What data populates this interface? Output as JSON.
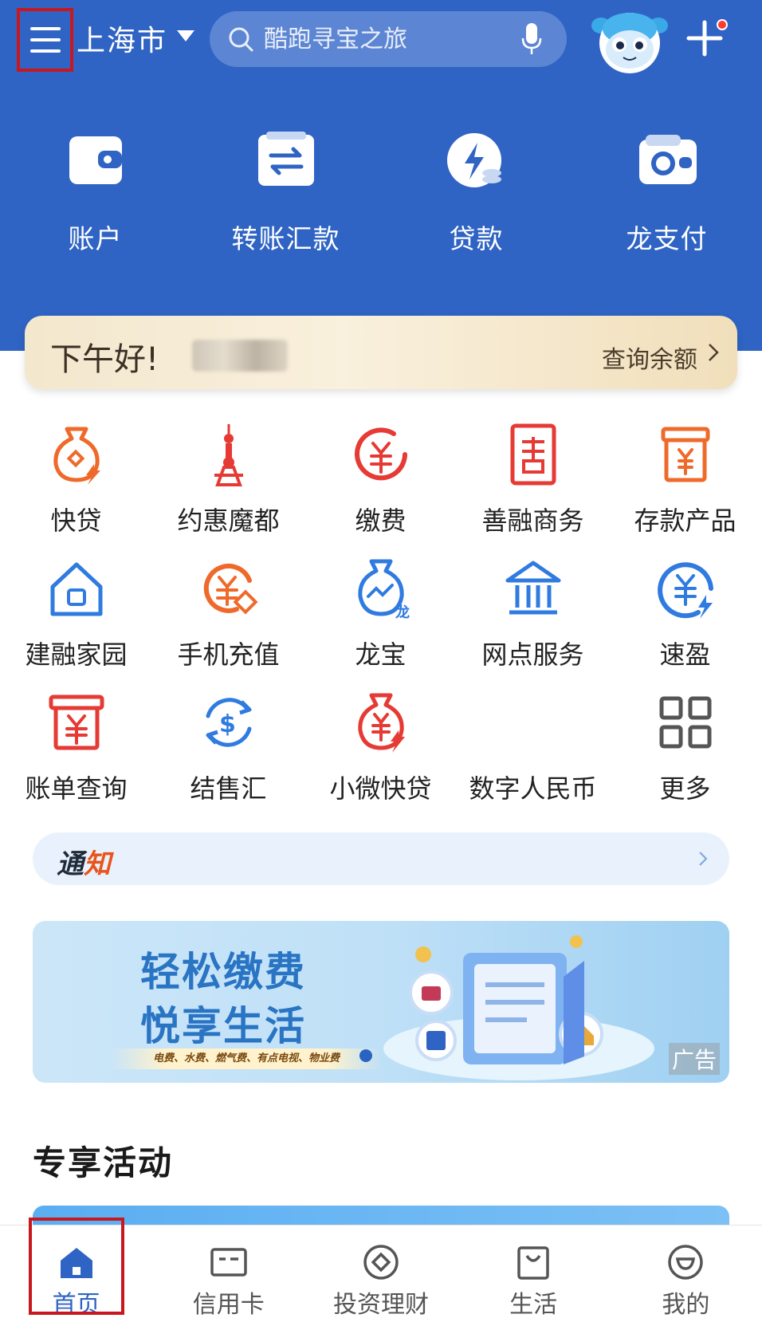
{
  "header": {
    "city": "上海市",
    "search_placeholder": "酷跑寻宝之旅"
  },
  "quick_actions": [
    {
      "label": "账户",
      "icon": "wallet-icon"
    },
    {
      "label": "转账汇款",
      "icon": "transfer-icon"
    },
    {
      "label": "贷款",
      "icon": "loan-icon"
    },
    {
      "label": "龙支付",
      "icon": "dragon-pay-icon"
    }
  ],
  "greeting": {
    "text": "下午好!",
    "balance_link": "查询余额"
  },
  "services": [
    [
      {
        "label": "快贷",
        "icon": "quick-loan-icon"
      },
      {
        "label": "约惠魔都",
        "icon": "oriental-pearl-tower-icon"
      },
      {
        "label": "缴费",
        "icon": "payment-icon"
      },
      {
        "label": "善融商务",
        "icon": "shanrong-commerce-icon"
      },
      {
        "label": "存款产品",
        "icon": "deposit-product-icon"
      }
    ],
    [
      {
        "label": "建融家园",
        "icon": "home-icon"
      },
      {
        "label": "手机充值",
        "icon": "phone-recharge-icon"
      },
      {
        "label": "龙宝",
        "icon": "longbao-icon"
      },
      {
        "label": "网点服务",
        "icon": "branch-service-icon"
      },
      {
        "label": "速盈",
        "icon": "suying-icon"
      }
    ],
    [
      {
        "label": "账单查询",
        "icon": "bill-query-icon"
      },
      {
        "label": "结售汇",
        "icon": "currency-exchange-icon"
      },
      {
        "label": "小微快贷",
        "icon": "micro-loan-icon"
      },
      {
        "label": "数字人民币",
        "icon": "digital-rmb-icon"
      },
      {
        "label": "更多",
        "icon": "more-grid-icon"
      }
    ]
  ],
  "notice": {
    "title_main": "通",
    "title_accent": "知"
  },
  "banner": {
    "title1": "轻松缴费",
    "title2": "悦享生活",
    "subtitle": "电费、水费、燃气费、有点电视、物业费",
    "ad_label": "广告"
  },
  "section": {
    "title": "专享活动"
  },
  "tabbar": [
    {
      "label": "首页",
      "icon": "home-tab-icon",
      "active": true
    },
    {
      "label": "信用卡",
      "icon": "credit-card-icon",
      "active": false
    },
    {
      "label": "投资理财",
      "icon": "invest-icon",
      "active": false
    },
    {
      "label": "生活",
      "icon": "life-bag-icon",
      "active": false
    },
    {
      "label": "我的",
      "icon": "profile-icon",
      "active": false
    }
  ],
  "colors": {
    "brand_blue": "#2f64c4",
    "highlight_red": "#c8181e",
    "icon_orange": "#ef6a2a",
    "icon_red": "#e63a34",
    "icon_blue": "#2f7be0"
  }
}
